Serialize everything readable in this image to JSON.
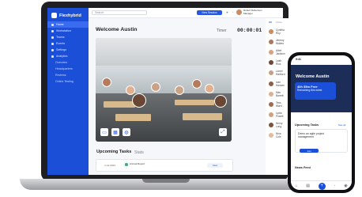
{
  "app": {
    "name": "Flexhybrid"
  },
  "sidebar": {
    "items": [
      {
        "label": "Home"
      },
      {
        "label": "Workstation"
      },
      {
        "label": "Teams"
      },
      {
        "label": "Events"
      },
      {
        "label": "Settings"
      },
      {
        "label": "Analytics"
      },
      {
        "label": "Overview"
      },
      {
        "label": "Headquarters"
      },
      {
        "label": "Reviews"
      },
      {
        "label": "Online Testing"
      }
    ]
  },
  "topbar": {
    "search_placeholder": "Search",
    "new_session": "New Session",
    "user_name": "Robert Robertson",
    "user_role": "Manager"
  },
  "main": {
    "welcome": "Welcome Austin",
    "timer_label": "Timer",
    "timer_value": "00:00:01",
    "tasks_title": "Upcoming Tasks",
    "stats_tab": "Stats",
    "task": {
      "date": "4 Jul 2023",
      "name": "Annual Report",
      "action": "View"
    }
  },
  "members_panel": {
    "tab_all": "All",
    "tab_active": "Active",
    "members": [
      {
        "name": "Cynthia Roy",
        "color": "#c98d62"
      },
      {
        "name": "Jeremy Mullins",
        "color": "#a8795f"
      },
      {
        "name": "Albie Jackson",
        "color": "#d6a382"
      },
      {
        "name": "Leah Rios",
        "color": "#6b4a3a"
      },
      {
        "name": "Lionel Hartford",
        "color": "#c4a184"
      },
      {
        "name": "Ivan Hansen",
        "color": "#8b5e47"
      },
      {
        "name": "Max Barrett",
        "color": "#d9b295"
      },
      {
        "name": "Tess Ward",
        "color": "#a06b52"
      },
      {
        "name": "Lydia Powell",
        "color": "#cfa17e"
      },
      {
        "name": "Henry Long",
        "color": "#7a5341"
      },
      {
        "name": "Nina Cole",
        "color": "#e2bb9b"
      }
    ]
  },
  "phone": {
    "time": "9:41",
    "welcome": "Welcome Austin",
    "card_title": "40h 35m Free",
    "card_sub": "Remaining this week",
    "tasks_title": "Upcoming Tasks",
    "tasks_link": "See all",
    "task_text": "Demo an agile project management",
    "task_join": "Join",
    "news_title": "News Feed"
  }
}
